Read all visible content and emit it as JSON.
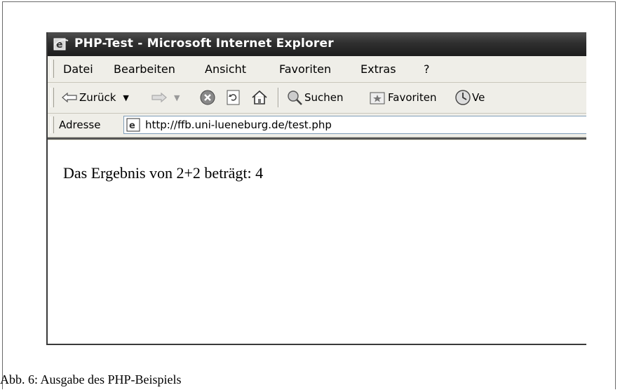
{
  "window": {
    "title": "PHP-Test - Microsoft Internet Explorer"
  },
  "menu": {
    "items": [
      "Datei",
      "Bearbeiten",
      "Ansicht",
      "Favoriten",
      "Extras",
      "?"
    ]
  },
  "toolbar": {
    "back_label": "Zurück",
    "search_label": "Suchen",
    "favorites_label": "Favoriten",
    "history_label_partial": "Ve"
  },
  "address": {
    "label": "Adresse",
    "url": "http://ffb.uni-lueneburg.de/test.php"
  },
  "page": {
    "text": "Das Ergebnis von 2+2 beträgt: 4"
  },
  "caption": "Abb. 6: Ausgabe des PHP-Beispiels",
  "icons": {
    "ie": "ie-logo-icon",
    "back": "back-arrow-icon",
    "forward": "forward-arrow-icon",
    "stop": "stop-icon",
    "refresh": "refresh-icon",
    "home": "home-icon",
    "search": "search-icon",
    "favorites": "favorites-icon",
    "history": "history-icon"
  }
}
